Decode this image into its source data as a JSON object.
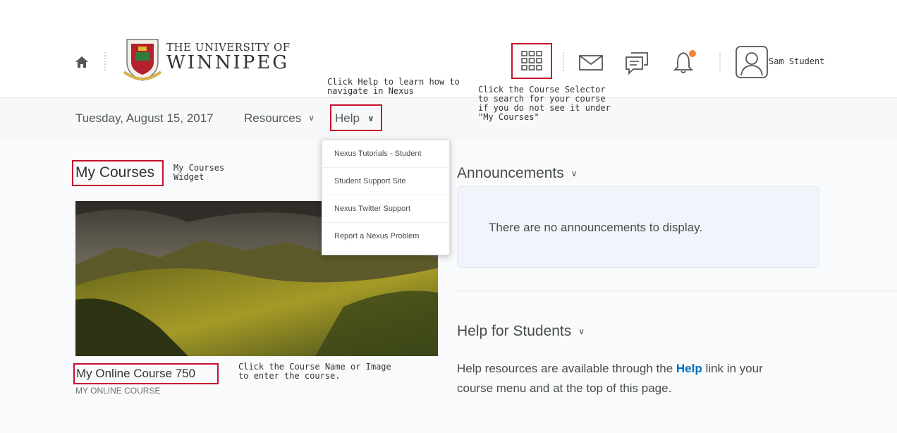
{
  "header": {
    "home_icon": "home-icon",
    "university_line1": "THE UNIVERSITY OF",
    "university_line2": "WINNIPEG",
    "user_name": "Sam Student",
    "notification_dot_color": "#f58232"
  },
  "nav": {
    "date": "Tuesday, August 15, 2017",
    "resources_label": "Resources",
    "help_label": "Help"
  },
  "help_menu": {
    "items": [
      {
        "label": "Nexus Tutorials - Student"
      },
      {
        "label": "Student Support Site"
      },
      {
        "label": "Nexus Twitter Support"
      },
      {
        "label": "Report a Nexus Problem"
      }
    ]
  },
  "my_courses": {
    "title": "My Courses",
    "course_name": "My Online Course 750",
    "course_code": "MY ONLINE COURSE"
  },
  "announcements": {
    "title": "Announcements",
    "empty_text": "There are no announcements to display."
  },
  "help_students": {
    "title": "Help for Students",
    "text_before": "Help resources are available through the ",
    "link": "Help",
    "text_after": " link in your",
    "text_line2": "course menu and at the top of this page."
  },
  "annotations": {
    "help_note": "Click Help to learn how to\nnavigate in Nexus",
    "selector_note": "Click the Course Selector\nto search for your course\nif you do not see it under\n\"My Courses\"",
    "widget_note": "My Courses\nWidget",
    "course_note": "Click the Course Name or Image\nto enter the course."
  },
  "colors": {
    "highlight": "#c8102e",
    "link": "#006fbf"
  }
}
